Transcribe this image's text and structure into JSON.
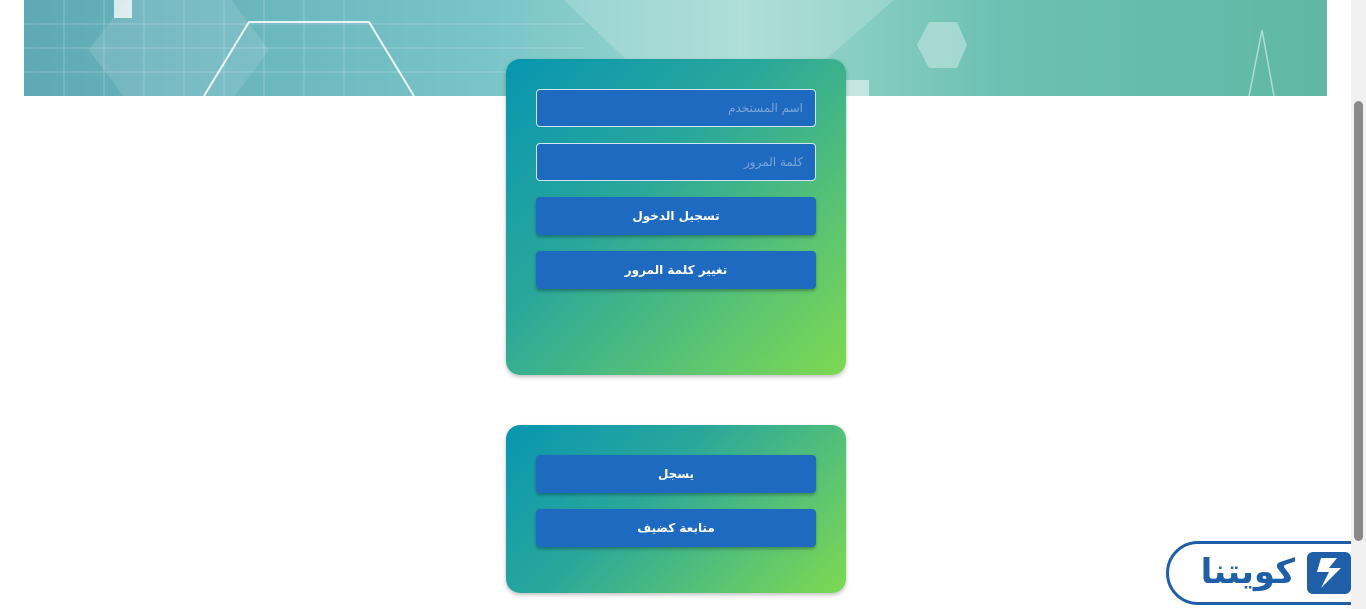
{
  "login": {
    "username_placeholder": "اسم المستخدم",
    "password_placeholder": "كلمة المرور",
    "login_button": "تسجيل الدخول",
    "change_password_button": "تغيير كلمة المرور"
  },
  "register": {
    "register_button": "يسجل",
    "guest_button": "متابعة كضيف"
  },
  "brand": {
    "name": "كويتنا",
    "color": "#1f5fa8"
  },
  "colors": {
    "card_gradient_start": "#0796b0",
    "card_gradient_end": "#7dd950",
    "button": "#1e6ac0"
  }
}
